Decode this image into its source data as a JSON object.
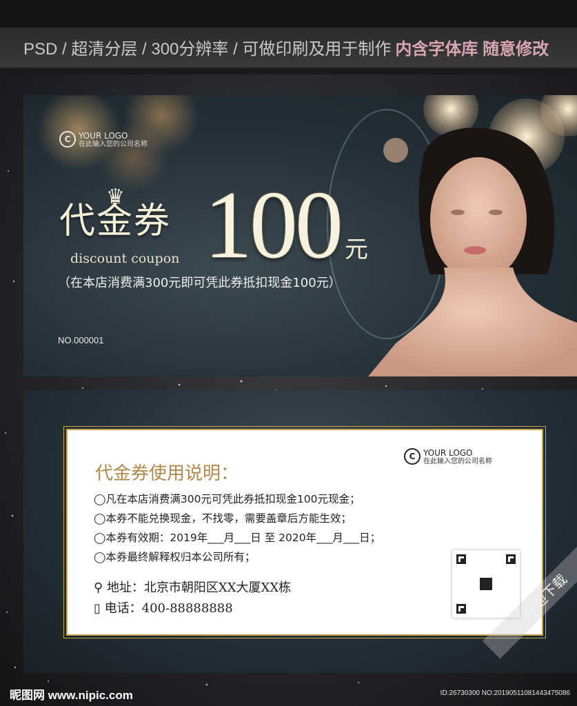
{
  "header": {
    "specs": "PSD  /  超清分层  /  300分辨率  /  可做印刷及用于制作",
    "highlight": "内含字体库 随意修改"
  },
  "front": {
    "logo_title": "YOUR LOGO",
    "logo_sub": "在此输入您的公司名称",
    "title_cn": "代金券",
    "title_en": "discount coupon",
    "amount": "100",
    "unit": "元",
    "condition": "（在本店消费满300元即可凭此券抵扣现金100元）",
    "serial": "NO.000001"
  },
  "back": {
    "logo_title": "YOUR LOGO",
    "logo_sub": "在此输入您的公司名称",
    "instructions_title": "代金券使用说明：",
    "rules": [
      "◯凡在本店消费满300元可凭此券抵扣现金100元现金；",
      "◯本券不能兑换现金，不找零，需要盖章后方能生效；",
      "◯本券有效期：2019年___月___日 至 2020年___月___日；",
      "◯本券最终解释权归本公司所有；"
    ],
    "address": "地址：北京市朝阳区XX大厦XX栋",
    "phone": "电话：400-88888888"
  },
  "ribbon": "欢迎下载",
  "footer": {
    "left": "昵图网 www.nipic.com",
    "right": "ID:26730300 NO:20190511081443475086"
  }
}
